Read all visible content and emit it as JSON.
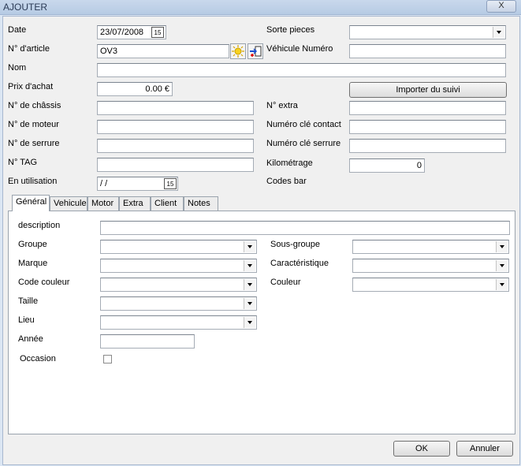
{
  "window": {
    "title": "AJOUTER",
    "close_glyph": "X"
  },
  "fields": {
    "date": {
      "label": "Date",
      "value": "23/07/2008"
    },
    "article": {
      "label": "N° d'article",
      "value": "OV3"
    },
    "nom": {
      "label": "Nom",
      "value": ""
    },
    "prix_achat": {
      "label": "Prix d'achat",
      "value": "0.00 €"
    },
    "chassis": {
      "label": "N° de châssis",
      "value": ""
    },
    "moteur": {
      "label": "N° de moteur",
      "value": ""
    },
    "serrure": {
      "label": "N° de serrure",
      "value": ""
    },
    "tag": {
      "label": "N° TAG",
      "value": ""
    },
    "en_utilisation": {
      "label": "En utilisation",
      "value": " / /"
    },
    "sorte_pieces": {
      "label": "Sorte pieces",
      "value": ""
    },
    "vehicule_numero": {
      "label": "Véhicule Numéro",
      "value": ""
    },
    "importer_button": "Importer du suivi",
    "extra": {
      "label": "N° extra",
      "value": ""
    },
    "cle_contact": {
      "label": "Numéro clé contact",
      "value": ""
    },
    "cle_serrure": {
      "label": "Numéro clé serrure",
      "value": ""
    },
    "kilometrage": {
      "label": "Kilométrage",
      "value": "0"
    },
    "codes_bar": {
      "label": "Codes bar"
    }
  },
  "calendar_glyph": "15",
  "tabs": [
    "Général",
    "Vehicule",
    "Motor",
    "Extra",
    "Client",
    "Notes"
  ],
  "general": {
    "description": {
      "label": "description",
      "value": ""
    },
    "groupe": {
      "label": "Groupe",
      "value": ""
    },
    "marque": {
      "label": "Marque",
      "value": ""
    },
    "code_couleur": {
      "label": "Code couleur",
      "value": ""
    },
    "taille": {
      "label": "Taille",
      "value": ""
    },
    "lieu": {
      "label": "Lieu",
      "value": ""
    },
    "annee": {
      "label": "Année",
      "value": ""
    },
    "occasion": {
      "label": "Occasion",
      "checked": false
    },
    "sous_groupe": {
      "label": "Sous-groupe",
      "value": ""
    },
    "caracteristique": {
      "label": "Caractéristique",
      "value": ""
    },
    "couleur": {
      "label": "Couleur",
      "value": ""
    }
  },
  "buttons": {
    "ok": "OK",
    "annuler": "Annuler"
  },
  "icons": [
    "close-icon",
    "calendar-icon",
    "new-article-icon",
    "insert-record-icon",
    "dropdown-arrow-icon"
  ]
}
